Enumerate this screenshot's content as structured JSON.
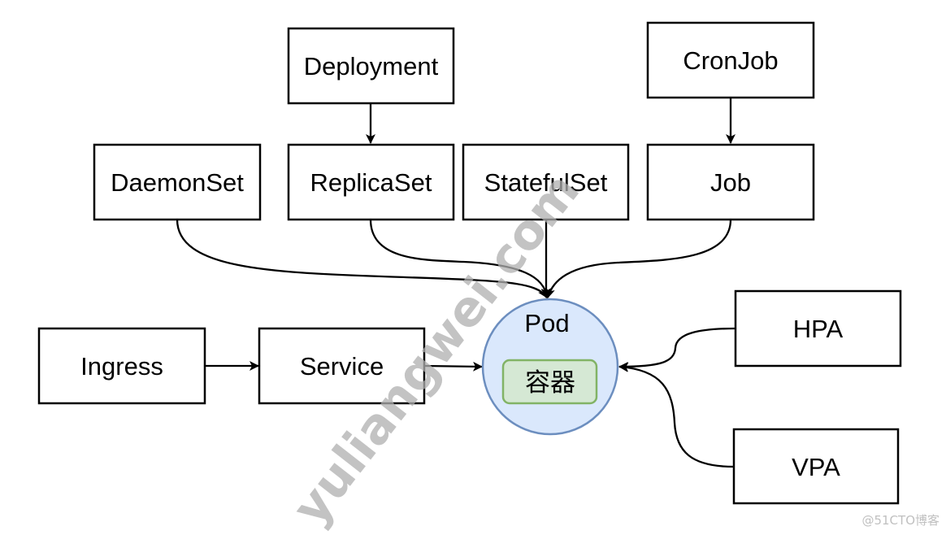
{
  "diagram": {
    "nodes": {
      "deployment": "Deployment",
      "cronjob": "CronJob",
      "daemonset": "DaemonSet",
      "replicaset": "ReplicaSet",
      "statefulset": "StatefulSet",
      "job": "Job",
      "ingress": "Ingress",
      "service": "Service",
      "pod": "Pod",
      "container": "容器",
      "hpa": "HPA",
      "vpa": "VPA"
    },
    "edges": [
      {
        "from": "Deployment",
        "to": "ReplicaSet"
      },
      {
        "from": "CronJob",
        "to": "Job"
      },
      {
        "from": "DaemonSet",
        "to": "Pod"
      },
      {
        "from": "ReplicaSet",
        "to": "Pod"
      },
      {
        "from": "StatefulSet",
        "to": "Pod"
      },
      {
        "from": "Job",
        "to": "Pod"
      },
      {
        "from": "Ingress",
        "to": "Service"
      },
      {
        "from": "Service",
        "to": "Pod"
      },
      {
        "from": "HPA",
        "to": "Pod"
      },
      {
        "from": "VPA",
        "to": "Pod"
      }
    ],
    "colors": {
      "pod_fill": "#dae8fc",
      "pod_stroke": "#6c8ebf",
      "container_fill": "#d5e8d4",
      "container_stroke": "#82b366"
    }
  },
  "watermark": "yuliangwei.com",
  "credit": "@51CTO博客"
}
